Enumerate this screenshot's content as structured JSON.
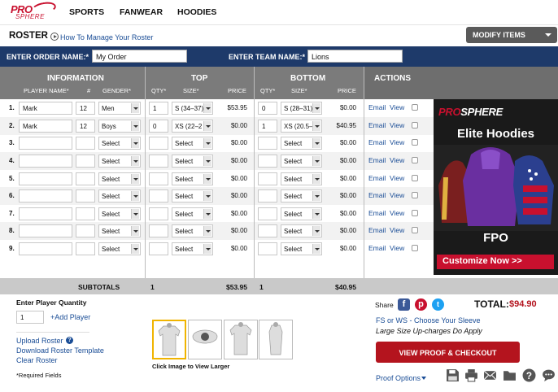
{
  "brand": {
    "logo_top": "PRO",
    "logo_bottom": "SPHERE"
  },
  "nav": {
    "sports": "SPORTS",
    "fanwear": "FANWEAR",
    "hoodies": "HOODIES"
  },
  "roster_bar": {
    "title": "ROSTER",
    "howto": "How To Manage Your Roster",
    "modify": "MODIFY ITEMS"
  },
  "order": {
    "order_label": "ENTER ORDER NAME:*",
    "order_value": "My Order",
    "team_label": "ENTER TEAM NAME:*",
    "team_value": "Lions"
  },
  "headers": {
    "information": "INFORMATION",
    "player_name": "PLAYER NAME*",
    "number": "#",
    "gender": "GENDER*",
    "top": "TOP",
    "top_qty": "QTY*",
    "top_size": "SIZE*",
    "top_price": "PRICE",
    "bottom": "BOTTOM",
    "bottom_qty": "QTY*",
    "bottom_size": "SIZE*",
    "bottom_price": "PRICE",
    "actions": "ACTIONS"
  },
  "rows": [
    {
      "n": "1.",
      "name": "Mark",
      "num": "12",
      "gender": "Men",
      "top_qty": "1",
      "top_size": "S (34–37)",
      "top_price": "$53.95",
      "bot_qty": "0",
      "bot_size": "S (28–31)",
      "bot_price": "$0.00"
    },
    {
      "n": "2.",
      "name": "Mark",
      "num": "12",
      "gender": "Boys",
      "top_qty": "0",
      "top_size": "XS (22–2",
      "top_price": "$0.00",
      "bot_qty": "1",
      "bot_size": "XS (20.5–",
      "bot_price": "$40.95"
    },
    {
      "n": "3.",
      "name": "",
      "num": "",
      "gender": "Select",
      "top_qty": "",
      "top_size": "Select",
      "top_price": "$0.00",
      "bot_qty": "",
      "bot_size": "Select",
      "bot_price": "$0.00"
    },
    {
      "n": "4.",
      "name": "",
      "num": "",
      "gender": "Select",
      "top_qty": "",
      "top_size": "Select",
      "top_price": "$0.00",
      "bot_qty": "",
      "bot_size": "Select",
      "bot_price": "$0.00"
    },
    {
      "n": "5.",
      "name": "",
      "num": "",
      "gender": "Select",
      "top_qty": "",
      "top_size": "Select",
      "top_price": "$0.00",
      "bot_qty": "",
      "bot_size": "Select",
      "bot_price": "$0.00"
    },
    {
      "n": "6.",
      "name": "",
      "num": "",
      "gender": "Select",
      "top_qty": "",
      "top_size": "Select",
      "top_price": "$0.00",
      "bot_qty": "",
      "bot_size": "Select",
      "bot_price": "$0.00"
    },
    {
      "n": "7.",
      "name": "",
      "num": "",
      "gender": "Select",
      "top_qty": "",
      "top_size": "Select",
      "top_price": "$0.00",
      "bot_qty": "",
      "bot_size": "Select",
      "bot_price": "$0.00"
    },
    {
      "n": "8.",
      "name": "",
      "num": "",
      "gender": "Select",
      "top_qty": "",
      "top_size": "Select",
      "top_price": "$0.00",
      "bot_qty": "",
      "bot_size": "Select",
      "bot_price": "$0.00"
    },
    {
      "n": "9.",
      "name": "",
      "num": "",
      "gender": "Select",
      "top_qty": "",
      "top_size": "Select",
      "top_price": "$0.00",
      "bot_qty": "",
      "bot_size": "Select",
      "bot_price": "$0.00"
    }
  ],
  "row_actions": {
    "email": "Email",
    "view": "View"
  },
  "ad": {
    "logo_a": "PRO",
    "logo_b": "SPHERE",
    "title": "Elite Hoodies",
    "fpo": "FPO",
    "cta": "Customize Now >>"
  },
  "subtotals": {
    "label": "SUBTOTALS",
    "top_qty": "1",
    "top_total": "$53.95",
    "bot_qty": "1",
    "bot_total": "$40.95"
  },
  "bottom": {
    "qty_label": "Enter Player Quantity",
    "qty_value": "1",
    "add_player": "+Add Player",
    "upload": "Upload Roster",
    "download": "Download Roster Template",
    "clear": "Clear Roster",
    "required": "*Required Fields",
    "thumbs_caption": "Click Image to View Larger",
    "share": "Share",
    "total_label": "TOTAL:",
    "total_value": "$94.90",
    "sleeve": "FS or WS - Choose Your Sleeve",
    "upcharge": "Large Size Up-charges Do Apply",
    "proof_btn": "VIEW PROOF & CHECKOUT",
    "proof_options": "Proof Options"
  },
  "colors": {
    "navy": "#1e3a6a",
    "red": "#b4141e",
    "link": "#1a4d96"
  },
  "icons": [
    "facebook-icon",
    "pinterest-icon",
    "twitter-icon",
    "save-icon",
    "print-icon",
    "email-icon",
    "folder-icon",
    "help-icon",
    "chat-icon"
  ]
}
